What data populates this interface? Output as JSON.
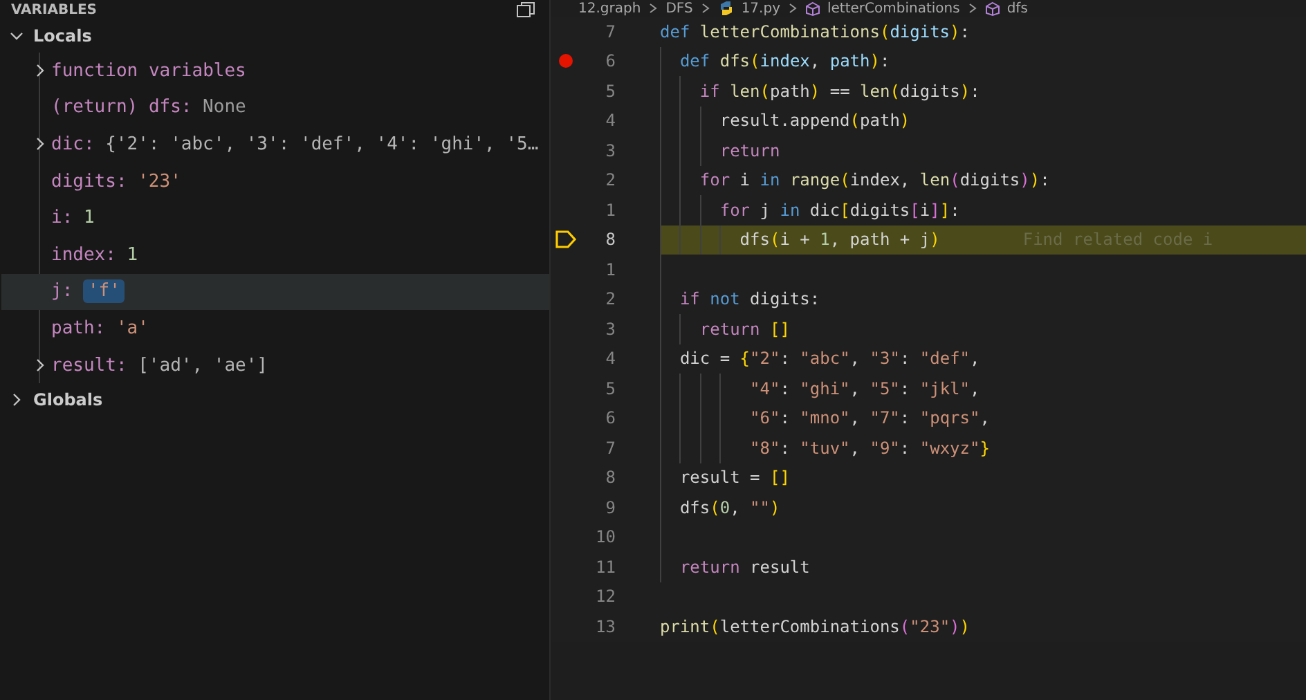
{
  "variables_panel": {
    "title": "VARIABLES",
    "scopes": [
      {
        "label": "Locals",
        "expanded": true,
        "children": [
          {
            "kind": "group",
            "name": "function variables",
            "expanded": false,
            "selected": false
          },
          {
            "kind": "plain",
            "name": "(return) dfs:",
            "value": "None",
            "color": "#9d9d9d",
            "selected": false,
            "changed": false
          },
          {
            "kind": "plain",
            "name": "dic:",
            "value": "{'2': 'abc', '3': 'def', '4': 'ghi', '5…",
            "color": "#b5b5b5",
            "expanded": false,
            "selected": false,
            "changed": false
          },
          {
            "kind": "plain",
            "name": "digits:",
            "value": "'23'",
            "color": "#ce9178",
            "selected": false,
            "changed": false
          },
          {
            "kind": "plain",
            "name": "i:",
            "value": "1",
            "color": "#b5cea8",
            "selected": false,
            "changed": false
          },
          {
            "kind": "plain",
            "name": "index:",
            "value": "1",
            "color": "#b5cea8",
            "selected": false,
            "changed": false
          },
          {
            "kind": "plain",
            "name": "j:",
            "value": "'f'",
            "color": "#ce9178",
            "selected": true,
            "changed": true
          },
          {
            "kind": "plain",
            "name": "path:",
            "value": "'a'",
            "color": "#ce9178",
            "selected": false,
            "changed": false
          },
          {
            "kind": "plain",
            "name": "result:",
            "value": "['ad', 'ae']",
            "color": "#b5b5b5",
            "expanded": false,
            "selected": false,
            "changed": false
          }
        ]
      },
      {
        "label": "Globals",
        "expanded": false
      }
    ]
  },
  "editor": {
    "breadcrumb": [
      {
        "kind": "folder",
        "label": "12.graph"
      },
      {
        "kind": "folder",
        "label": "DFS"
      },
      {
        "kind": "python",
        "label": "17.py"
      },
      {
        "kind": "symbol",
        "label": "letterCombinations"
      },
      {
        "kind": "symbol",
        "label": "dfs"
      }
    ],
    "lines": [
      {
        "number": "7",
        "breakpoint": false,
        "current": false,
        "tokens": [
          {
            "kind": "keyword",
            "text": "def "
          },
          {
            "kind": "function",
            "text": "letterCombinations"
          },
          {
            "kind": "bracket",
            "text": "("
          },
          {
            "kind": "parameter",
            "text": "digits"
          },
          {
            "kind": "bracket",
            "text": ")"
          },
          {
            "kind": "plain",
            "text": ":"
          }
        ]
      },
      {
        "number": "6",
        "breakpoint": true,
        "current": false,
        "tokens": [
          {
            "kind": "keyword",
            "text": "  def "
          },
          {
            "kind": "function",
            "text": "dfs"
          },
          {
            "kind": "bracket",
            "text": "("
          },
          {
            "kind": "parameter",
            "text": "index"
          },
          {
            "kind": "plain",
            "text": ", "
          },
          {
            "kind": "parameter",
            "text": "path"
          },
          {
            "kind": "bracket",
            "text": ")"
          },
          {
            "kind": "plain",
            "text": ":"
          }
        ]
      },
      {
        "number": "5",
        "breakpoint": false,
        "current": false,
        "tokens": [
          {
            "kind": "control",
            "text": "    if "
          },
          {
            "kind": "function",
            "text": "len"
          },
          {
            "kind": "bracket",
            "text": "("
          },
          {
            "kind": "plain",
            "text": "path"
          },
          {
            "kind": "bracket",
            "text": ")"
          },
          {
            "kind": "plain",
            "text": " == "
          },
          {
            "kind": "function",
            "text": "len"
          },
          {
            "kind": "bracket",
            "text": "("
          },
          {
            "kind": "plain",
            "text": "digits"
          },
          {
            "kind": "bracket",
            "text": ")"
          },
          {
            "kind": "plain",
            "text": ":"
          }
        ]
      },
      {
        "number": "4",
        "breakpoint": false,
        "current": false,
        "tokens": [
          {
            "kind": "plain",
            "text": "      result.append"
          },
          {
            "kind": "bracket",
            "text": "("
          },
          {
            "kind": "plain",
            "text": "path"
          },
          {
            "kind": "bracket",
            "text": ")"
          }
        ]
      },
      {
        "number": "3",
        "breakpoint": false,
        "current": false,
        "tokens": [
          {
            "kind": "control",
            "text": "      return"
          }
        ]
      },
      {
        "number": "2",
        "breakpoint": false,
        "current": false,
        "tokens": [
          {
            "kind": "control",
            "text": "    for"
          },
          {
            "kind": "plain",
            "text": " i "
          },
          {
            "kind": "keyword",
            "text": "in "
          },
          {
            "kind": "function",
            "text": "range"
          },
          {
            "kind": "bracket",
            "text": "("
          },
          {
            "kind": "plain",
            "text": "index, "
          },
          {
            "kind": "function",
            "text": "len"
          },
          {
            "kind": "bracket2",
            "text": "("
          },
          {
            "kind": "plain",
            "text": "digits"
          },
          {
            "kind": "bracket2",
            "text": ")"
          },
          {
            "kind": "bracket",
            "text": ")"
          },
          {
            "kind": "plain",
            "text": ":"
          }
        ]
      },
      {
        "number": "1",
        "breakpoint": false,
        "current": false,
        "tokens": [
          {
            "kind": "control",
            "text": "      for"
          },
          {
            "kind": "plain",
            "text": " j "
          },
          {
            "kind": "keyword",
            "text": "in"
          },
          {
            "kind": "plain",
            "text": " dic"
          },
          {
            "kind": "bracket",
            "text": "["
          },
          {
            "kind": "plain",
            "text": "digits"
          },
          {
            "kind": "bracket2",
            "text": "["
          },
          {
            "kind": "plain",
            "text": "i"
          },
          {
            "kind": "bracket2",
            "text": "]"
          },
          {
            "kind": "bracket",
            "text": "]"
          },
          {
            "kind": "plain",
            "text": ":"
          }
        ]
      },
      {
        "number": "8",
        "breakpoint": false,
        "current": true,
        "hint": "Find related code i",
        "tokens": [
          {
            "kind": "plain",
            "text": "        dfs"
          },
          {
            "kind": "bracket",
            "text": "("
          },
          {
            "kind": "plain",
            "text": "i + "
          },
          {
            "kind": "number",
            "text": "1"
          },
          {
            "kind": "plain",
            "text": ", path + j"
          },
          {
            "kind": "bracket",
            "text": ")"
          }
        ]
      },
      {
        "number": "1",
        "breakpoint": false,
        "current": false
      },
      {
        "number": "2",
        "breakpoint": false,
        "current": false,
        "tokens": [
          {
            "kind": "control",
            "text": "  if "
          },
          {
            "kind": "keyword",
            "text": "not"
          },
          {
            "kind": "plain",
            "text": " digits:"
          }
        ]
      },
      {
        "number": "3",
        "breakpoint": false,
        "current": false,
        "tokens": [
          {
            "kind": "control",
            "text": "    return "
          },
          {
            "kind": "bracket",
            "text": "[]"
          }
        ]
      },
      {
        "number": "4",
        "breakpoint": false,
        "current": false,
        "tokens": [
          {
            "kind": "plain",
            "text": "  dic = "
          },
          {
            "kind": "bracket",
            "text": "{"
          },
          {
            "kind": "string",
            "text": "\"2\""
          },
          {
            "kind": "plain",
            "text": ": "
          },
          {
            "kind": "string",
            "text": "\"abc\""
          },
          {
            "kind": "plain",
            "text": ", "
          },
          {
            "kind": "string",
            "text": "\"3\""
          },
          {
            "kind": "plain",
            "text": ": "
          },
          {
            "kind": "string",
            "text": "\"def\""
          },
          {
            "kind": "plain",
            "text": ","
          }
        ]
      },
      {
        "number": "5",
        "breakpoint": false,
        "current": false,
        "tokens": [
          {
            "kind": "string",
            "text": "         \"4\""
          },
          {
            "kind": "plain",
            "text": ": "
          },
          {
            "kind": "string",
            "text": "\"ghi\""
          },
          {
            "kind": "plain",
            "text": ", "
          },
          {
            "kind": "string",
            "text": "\"5\""
          },
          {
            "kind": "plain",
            "text": ": "
          },
          {
            "kind": "string",
            "text": "\"jkl\""
          },
          {
            "kind": "plain",
            "text": ","
          }
        ]
      },
      {
        "number": "6",
        "breakpoint": false,
        "current": false,
        "tokens": [
          {
            "kind": "string",
            "text": "         \"6\""
          },
          {
            "kind": "plain",
            "text": ": "
          },
          {
            "kind": "string",
            "text": "\"mno\""
          },
          {
            "kind": "plain",
            "text": ", "
          },
          {
            "kind": "string",
            "text": "\"7\""
          },
          {
            "kind": "plain",
            "text": ": "
          },
          {
            "kind": "string",
            "text": "\"pqrs\""
          },
          {
            "kind": "plain",
            "text": ","
          }
        ]
      },
      {
        "number": "7",
        "breakpoint": false,
        "current": false,
        "tokens": [
          {
            "kind": "string",
            "text": "         \"8\""
          },
          {
            "kind": "plain",
            "text": ": "
          },
          {
            "kind": "string",
            "text": "\"tuv\""
          },
          {
            "kind": "plain",
            "text": ", "
          },
          {
            "kind": "string",
            "text": "\"9\""
          },
          {
            "kind": "plain",
            "text": ": "
          },
          {
            "kind": "string",
            "text": "\"wxyz\""
          },
          {
            "kind": "bracket",
            "text": "}"
          }
        ]
      },
      {
        "number": "8",
        "breakpoint": false,
        "current": false,
        "tokens": [
          {
            "kind": "plain",
            "text": "  result = "
          },
          {
            "kind": "bracket",
            "text": "[]"
          }
        ]
      },
      {
        "number": "9",
        "breakpoint": false,
        "current": false,
        "tokens": [
          {
            "kind": "plain",
            "text": "  dfs"
          },
          {
            "kind": "bracket",
            "text": "("
          },
          {
            "kind": "number",
            "text": "0"
          },
          {
            "kind": "plain",
            "text": ", "
          },
          {
            "kind": "string",
            "text": "\"\""
          },
          {
            "kind": "bracket",
            "text": ")"
          }
        ]
      },
      {
        "number": "10",
        "breakpoint": false,
        "current": false
      },
      {
        "number": "11",
        "breakpoint": false,
        "current": false,
        "tokens": [
          {
            "kind": "control",
            "text": "  return"
          },
          {
            "kind": "plain",
            "text": " result"
          }
        ]
      },
      {
        "number": "12",
        "breakpoint": false,
        "current": false
      },
      {
        "number": "13",
        "breakpoint": false,
        "current": false,
        "tokens": [
          {
            "kind": "function",
            "text": "print"
          },
          {
            "kind": "bracket",
            "text": "("
          },
          {
            "kind": "plain",
            "text": "letterCombinations"
          },
          {
            "kind": "bracket2",
            "text": "("
          },
          {
            "kind": "string",
            "text": "\"23\""
          },
          {
            "kind": "bracket2",
            "text": ")"
          },
          {
            "kind": "bracket",
            "text": ")"
          }
        ]
      }
    ]
  }
}
